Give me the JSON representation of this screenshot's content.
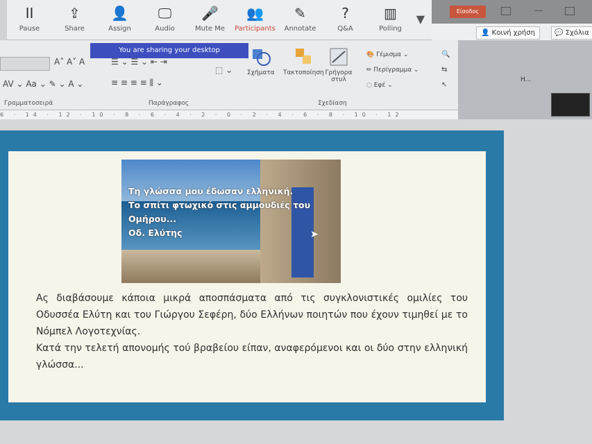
{
  "share_toolbar": {
    "items": [
      {
        "label": "Pause",
        "icon": "pause-icon",
        "glyph": "II"
      },
      {
        "label": "Share",
        "icon": "share-icon",
        "glyph": "⇪"
      },
      {
        "label": "Assign",
        "icon": "assign-icon",
        "glyph": "👤"
      },
      {
        "label": "Audio",
        "icon": "audio-icon",
        "glyph": "🖵"
      },
      {
        "label": "Mute Me",
        "icon": "mic-icon",
        "glyph": "🎤"
      },
      {
        "label": "Participants",
        "icon": "participants-icon",
        "glyph": "👥"
      },
      {
        "label": "Annotate",
        "icon": "pencil-icon",
        "glyph": "✎"
      },
      {
        "label": "Q&A",
        "icon": "qa-icon",
        "glyph": "?"
      },
      {
        "label": "Polling",
        "icon": "polling-icon",
        "glyph": "▥"
      }
    ],
    "banner": "You are sharing your desktop"
  },
  "top_right": {
    "signin": "Είσοδος",
    "chips": [
      "Κοινή χρήση",
      "Σχόλια"
    ]
  },
  "ribbon": {
    "groups": [
      "Γραμματοσειρά",
      "Παράγραφος",
      "Σχεδίαση"
    ],
    "buttons": [
      "Σχήματα",
      "Τακτοποίηση",
      "Γρήγορα στυλ"
    ],
    "shape_options": [
      "Γέμισμα",
      "Περίγραμμα",
      "Εφέ"
    ],
    "ruler": "6 · 14 · 12 · 10 · 8 · 6 · 4 · 2 · 0 · 2 · 4 · 6 · 8 · 10 · 12"
  },
  "video": {
    "name": "H..."
  },
  "slide": {
    "quote_lines": [
      "Τη γλώσσα μου έδωσαν ελληνική.",
      "Το σπίτι φτωχικό στις αμμουδιές του",
      "Ομήρου...",
      "Οδ. Ελύτης"
    ],
    "paragraph_1": "Ας διαβάσουμε κάποια μικρά αποσπάσματα από τις συγκλονιστικές ομιλίες του Οδυσσέα Ελύτη και του Γιώργου Σεφέρη, δύο Ελλήνων ποιητών που έχουν τιμηθεί με το Νόμπελ Λογοτεχνίας.",
    "paragraph_2": "Κατά την τελετή απονομής τού βραβείου είπαν, αναφερόμενοι και οι δύο στην ελληνική γλώσσα..."
  }
}
